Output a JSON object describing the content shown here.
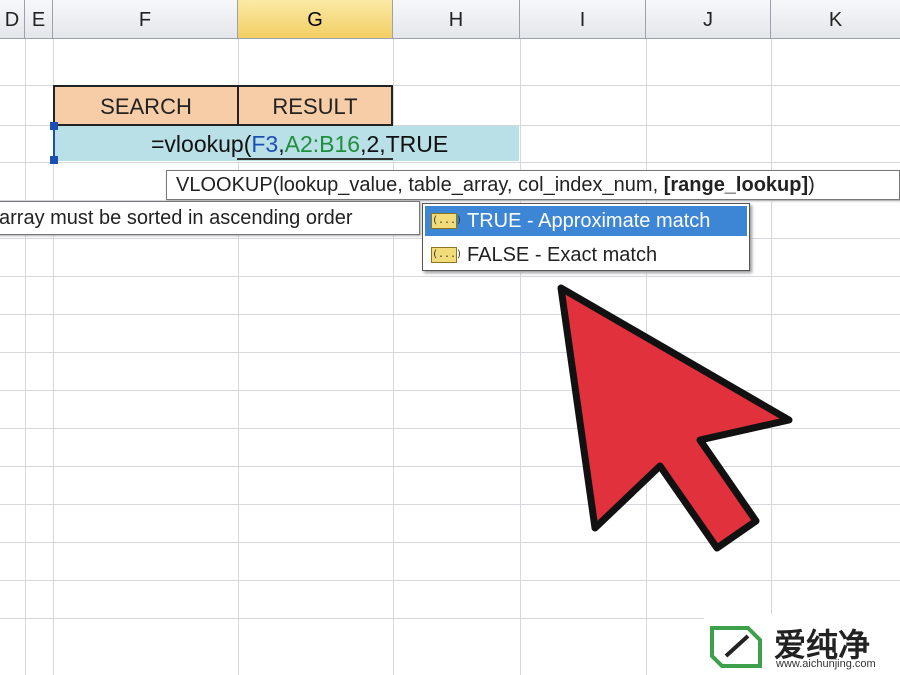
{
  "columns": [
    "D",
    "E",
    "F",
    "G",
    "H",
    "I",
    "J",
    "K"
  ],
  "active_column": "G",
  "cells": {
    "search_header": "SEARCH",
    "result_header": "RESULT"
  },
  "formula": {
    "prefix": "=vlookup(",
    "ref1": "F3",
    "sep1": ",",
    "ref2": "A2:B16",
    "rest": ",2,TRUE"
  },
  "tooltips": {
    "signature": "VLOOKUP(lookup_value, table_array, col_index_num, [range_lookup])",
    "signature_fn": "VLOOKUP(lookup_value, table_array, col_index_num, ",
    "signature_active": "[range_lookup]",
    "signature_tail": ")",
    "hint": "array must be sorted in ascending order"
  },
  "dropdown": {
    "items": [
      {
        "label": "TRUE - Approximate match",
        "selected": true,
        "icon": "argument-icon"
      },
      {
        "label": "FALSE - Exact match",
        "selected": false,
        "icon": "argument-icon"
      }
    ]
  },
  "watermark": {
    "text": "爱纯净",
    "url": "www.aichunjing.com"
  },
  "colors": {
    "active_column_header": "#f2cf63",
    "header_cell_fill": "#f7cda8",
    "formula_cell_fill": "#b9dfe7",
    "dropdown_selected": "#3d86d6",
    "arrow_fill": "#e0313c"
  }
}
